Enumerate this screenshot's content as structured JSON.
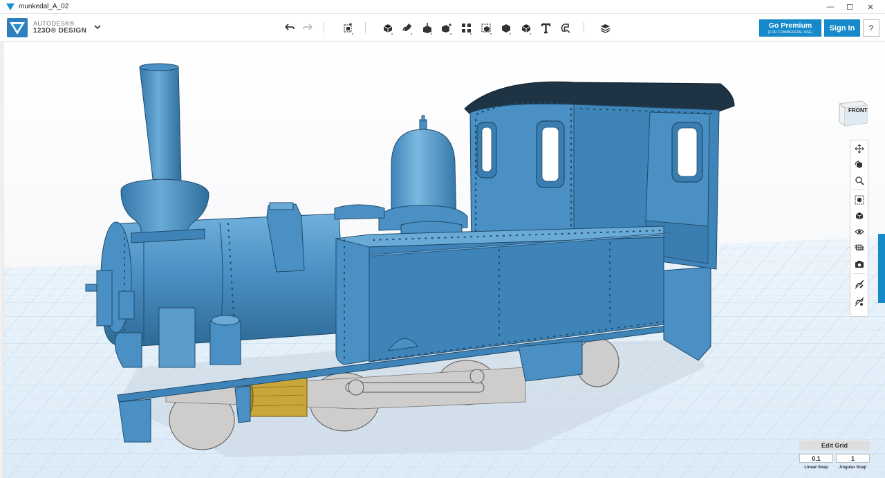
{
  "window": {
    "title": "munkedal_A_02",
    "controls": {
      "minimize": "—",
      "maximize": "☐",
      "close": "✕"
    }
  },
  "brand": {
    "line1": "AUTODESK®",
    "line2": "123D® DESIGN",
    "color": "#1f8fd0"
  },
  "toolbar": {
    "icons": [
      "undo-icon",
      "redo-icon",
      "transform-icon",
      "primitives-icon",
      "sketch-icon",
      "construct-icon",
      "modify-icon",
      "pattern-icon",
      "grouping-icon",
      "combine-icon",
      "measure-icon",
      "text-icon",
      "snap-icon",
      "material-icon"
    ]
  },
  "account": {
    "premium_label": "Go Premium",
    "premium_sub": "(FOR COMMERCIAL USE)",
    "signin_label": "Sign In",
    "help_label": "?",
    "accent": "#1589c9"
  },
  "viewcube": {
    "face_label": "FRONT"
  },
  "navbar": {
    "icons": [
      "pan-icon",
      "orbit-icon",
      "zoom-icon",
      "fit-icon",
      "view-cube-icon",
      "visibility-icon",
      "material-display-icon",
      "screenshot-icon",
      "hide-sketches-icon",
      "hide-meshes-icon"
    ]
  },
  "grid": {
    "edit_label": "Edit Grid",
    "linear_value": "0.1",
    "angular_value": "1",
    "linear_label": "Linear Snap",
    "angular_label": "Angular Snap"
  },
  "model": {
    "body_color": "#4a90c4",
    "body_light": "#6aaad6",
    "body_dark": "#2f6f9c",
    "roof_color": "#1e3344",
    "wheel_color": "#cfcdcb",
    "motor_color": "#c9a63a",
    "grid_color": "#c3dbef"
  }
}
